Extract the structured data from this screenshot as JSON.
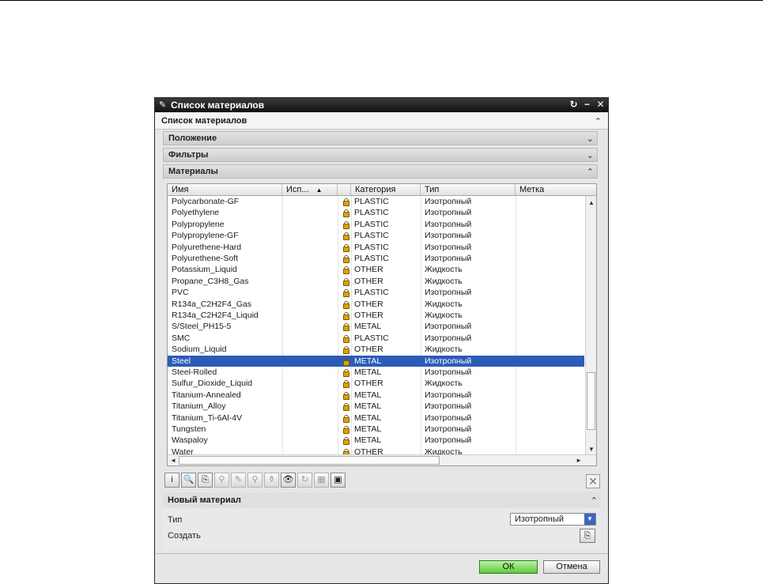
{
  "window": {
    "title": "Список материалов",
    "controls": [
      "↻",
      "−",
      "✕"
    ]
  },
  "dialog": {
    "header": "Список материалов",
    "sections": {
      "position": "Положение",
      "filters": "Фильтры",
      "materials": "Материалы"
    }
  },
  "table": {
    "columns": [
      "Имя",
      "Исп...",
      "Категория",
      "Тип",
      "Метка"
    ],
    "sort_indicator": "▲",
    "selected_index": 14,
    "rows": [
      {
        "name": "Polycarbonate-GF",
        "category": "PLASTIC",
        "type": "Изотропный"
      },
      {
        "name": "Polyethylene",
        "category": "PLASTIC",
        "type": "Изотропный"
      },
      {
        "name": "Polypropylene",
        "category": "PLASTIC",
        "type": "Изотропный"
      },
      {
        "name": "Polypropylene-GF",
        "category": "PLASTIC",
        "type": "Изотропный"
      },
      {
        "name": "Polyurethene-Hard",
        "category": "PLASTIC",
        "type": "Изотропный"
      },
      {
        "name": "Polyurethene-Soft",
        "category": "PLASTIC",
        "type": "Изотропный"
      },
      {
        "name": "Potassium_Liquid",
        "category": "OTHER",
        "type": "Жидкость"
      },
      {
        "name": "Propane_C3H8_Gas",
        "category": "OTHER",
        "type": "Жидкость"
      },
      {
        "name": "PVC",
        "category": "PLASTIC",
        "type": "Изотропный"
      },
      {
        "name": "R134a_C2H2F4_Gas",
        "category": "OTHER",
        "type": "Жидкость"
      },
      {
        "name": "R134a_C2H2F4_Liquid",
        "category": "OTHER",
        "type": "Жидкость"
      },
      {
        "name": "S/Steel_PH15-5",
        "category": "METAL",
        "type": "Изотропный"
      },
      {
        "name": "SMC",
        "category": "PLASTIC",
        "type": "Изотропный"
      },
      {
        "name": "Sodium_Liquid",
        "category": "OTHER",
        "type": "Жидкость"
      },
      {
        "name": "Steel",
        "category": "METAL",
        "type": "Изотропный"
      },
      {
        "name": "Steel-Rolled",
        "category": "METAL",
        "type": "Изотропный"
      },
      {
        "name": "Sulfur_Dioxide_Liquid",
        "category": "OTHER",
        "type": "Жидкость"
      },
      {
        "name": "Titanium-Annealed",
        "category": "METAL",
        "type": "Изотропный"
      },
      {
        "name": "Titanium_Alloy",
        "category": "METAL",
        "type": "Изотропный"
      },
      {
        "name": "Titanium_Ti-6Al-4V",
        "category": "METAL",
        "type": "Изотропный"
      },
      {
        "name": "Tungsten",
        "category": "METAL",
        "type": "Изотропный"
      },
      {
        "name": "Waspaloy",
        "category": "METAL",
        "type": "Изотропный"
      },
      {
        "name": "Water",
        "category": "OTHER",
        "type": "Жидкость"
      }
    ]
  },
  "toolbar": {
    "tools": [
      {
        "icon": "info-icon",
        "glyph": "i",
        "enabled": true
      },
      {
        "icon": "inspect-icon",
        "glyph": "🔍",
        "enabled": true
      },
      {
        "icon": "copy-icon",
        "glyph": "⎘",
        "enabled": true
      },
      {
        "icon": "search-icon",
        "glyph": "⚲",
        "enabled": false
      },
      {
        "icon": "edit-icon",
        "glyph": "✎",
        "enabled": false
      },
      {
        "icon": "find-icon",
        "glyph": "⚲",
        "enabled": false
      },
      {
        "icon": "assign-icon",
        "glyph": "⚱",
        "enabled": false
      },
      {
        "icon": "view-icon",
        "glyph": "👁",
        "enabled": true
      },
      {
        "icon": "refresh-icon",
        "glyph": "↻",
        "enabled": false
      },
      {
        "icon": "library-icon",
        "glyph": "▦",
        "enabled": false
      },
      {
        "icon": "export-icon",
        "glyph": "▣",
        "enabled": true
      }
    ],
    "close_glyph": "✕"
  },
  "new_material": {
    "header": "Новый материал",
    "type_label": "Тип",
    "type_value": "Изотропный",
    "create_label": "Создать"
  },
  "footer": {
    "ok_label": "ОК",
    "cancel_label": "Отмена"
  },
  "colors": {
    "selection": "#2b5cb8",
    "ok_green": "#5fcb3c",
    "lock_gold": "#d9a400"
  }
}
